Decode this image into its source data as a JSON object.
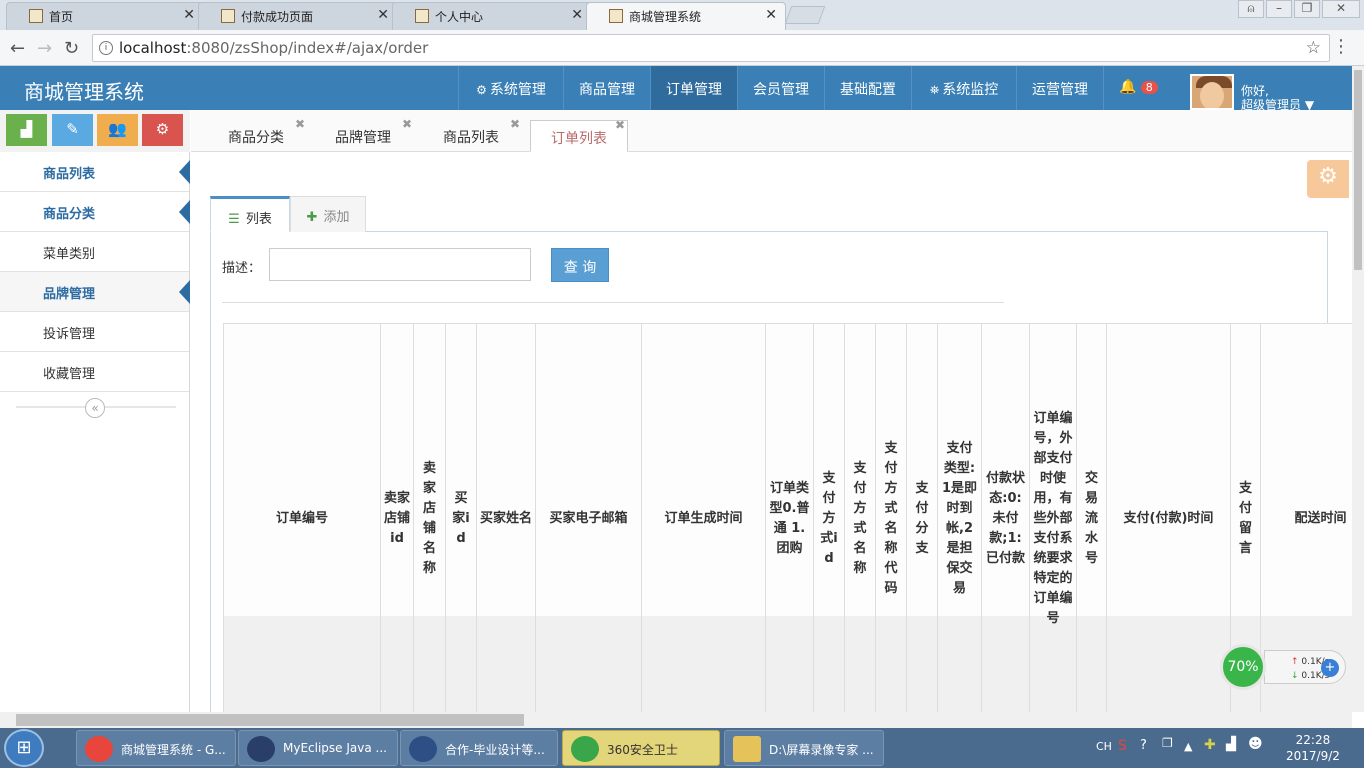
{
  "browser": {
    "tabs": [
      {
        "label": "首页"
      },
      {
        "label": "付款成功页面"
      },
      {
        "label": "个人中心"
      },
      {
        "label": "商城管理系统"
      }
    ],
    "url_host": "localhost",
    "url_path": ":8080/zsShop/index#/ajax/order"
  },
  "header": {
    "app_name": "商城管理系统",
    "nav": [
      {
        "label": "系统管理"
      },
      {
        "label": "商品管理"
      },
      {
        "label": "订单管理"
      },
      {
        "label": "会员管理"
      },
      {
        "label": "基础配置"
      },
      {
        "label": "系统监控"
      },
      {
        "label": "运营管理"
      }
    ],
    "notification_count": "8",
    "greeting_line1": "你好,",
    "greeting_line2": "超级管理员"
  },
  "sidebar": {
    "items": [
      {
        "label": "商品列表"
      },
      {
        "label": "商品分类"
      },
      {
        "label": "菜单类别"
      },
      {
        "label": "品牌管理"
      },
      {
        "label": "投诉管理"
      },
      {
        "label": "收藏管理"
      }
    ],
    "collapse_glyph": "«"
  },
  "content_tabs": [
    {
      "label": "商品分类"
    },
    {
      "label": "品牌管理"
    },
    {
      "label": "商品列表"
    },
    {
      "label": "订单列表"
    }
  ],
  "list_tabs": {
    "list": "列表",
    "add": "添加"
  },
  "search": {
    "label": "描述：",
    "button": "查 询"
  },
  "table": {
    "columns": [
      "订单编号",
      "卖家店铺id",
      "卖家店铺名称",
      "买家id",
      "买家姓名",
      "买家电子邮箱",
      "订单生成时间",
      "订单类型0.普通 1.团购",
      "支付方式id",
      "支付方式名称",
      "支付方式名称代码",
      "支付分支",
      "支付类型:1是即时到帐,2是担保交易",
      "付款状态:0:未付款;1:已付款",
      "订单编号，外部支付时使用，有些外部支付系统要求特定的订单编号",
      "交易流水号",
      "支付(付款)时间",
      "支付留言",
      "配送时间"
    ]
  },
  "network_widget": {
    "percent": "70%",
    "up": "0.1K/s",
    "down": "0.1K/s"
  },
  "taskbar": {
    "items": [
      {
        "label": "商城管理系统 - G..."
      },
      {
        "label": "MyEclipse Java ..."
      },
      {
        "label": "合作-毕业设计等..."
      },
      {
        "label": "360安全卫士"
      },
      {
        "label": "D:\\屏幕录像专家 ..."
      }
    ],
    "tray_lang": "CH",
    "time": "22:28",
    "date": "2017/9/2"
  }
}
